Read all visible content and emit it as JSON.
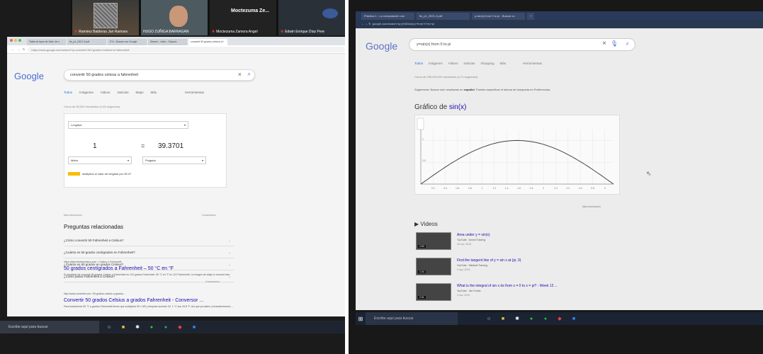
{
  "zoom": {
    "participants": [
      {
        "name": "Ramirez Balderas Jair Ramses"
      },
      {
        "name": "HUGO ZUÑIGA BARRAGAN"
      },
      {
        "name": "Moctezuma Zamora Angel",
        "big_name": "Moctezuma Ze..."
      },
      {
        "name": "Edwin Enrique Díaz Pere"
      }
    ]
  },
  "left_browser": {
    "tabs": [
      {
        "label": "Tabla de tipos de Valor de c"
      },
      {
        "label": "fis_p1_2021-3.pdf"
      },
      {
        "label": "3°A - Buscar con Google"
      },
      {
        "label": "Search - video - Edpuzz"
      },
      {
        "label": "convertir 50 grados celsius a f"
      }
    ],
    "url": "https://www.google.com/search?q=convertir+50+grados+celsius+a+fahrenheit",
    "logo": "Google",
    "search_query": "convertir 50 grados celsius a fahrenheit",
    "search_tabs": [
      "Todos",
      "Imágenes",
      "Videos",
      "Noticias",
      "Maps",
      "Más"
    ],
    "tools_label": "Herramientas",
    "result_count": "Cerca de 83,000 resultados (0,43 segundos)",
    "converter": {
      "category": "Longitud",
      "from_value": "1",
      "equals": "=",
      "to_value": "39.3701",
      "from_unit": "Metro",
      "to_unit": "Pulgada",
      "formula_text": "multiplica el valor de longitud por 39.37"
    },
    "more_info": "Más información",
    "comments_label": "Comentarios",
    "faq_title": "Preguntas relacionadas",
    "faq": [
      "¿Cómo convertir 50 Fahrenheit a Celsius?",
      "¿Cuánto es 50 grados centígrados en Fahrenheit?",
      "¿Cuánto es 50 grados en grados Celsius?",
      "¿Cómo pasar Fahrenheit a Celsius?"
    ],
    "result1": {
      "url": "https://fahrenheitacelsius.com › Celsius a Fahrenheit",
      "title": "50 grados centígrados a Fahrenheit – 50 °C en °F",
      "snippet": "El resultado de convertir 50 grados Celsius a Fahrenheit es 122 grados Fahrenheit. 50 °C en °F es 122 Fahrenheit. La imagen de abajo lo resume todo."
    },
    "result2": {
      "url": "http://www.convertir.com › 50-grados-celsius-a-grados...",
      "title": "Convertir 50 grados Celsius a grados Fahrenheit - Conversor ...",
      "snippet": "Para transformar 50 °C a grados Fahrenheit tienes que multiplicar 50 x 9/5 y después sumarle 32. 1 °C son 33,8 °F. Así que ya sabes, la transformación ..."
    },
    "taskbar_search": "Escribe aquí para buscar"
  },
  "right_browser": {
    "tabs": [
      {
        "label": "Práctica 1 - La computación con"
      },
      {
        "label": "fis_p1_2021-3.pdf"
      },
      {
        "label": "y=sin(x) from 0 to pi - Buscar co"
      }
    ],
    "url": "google.com/search?q=y%3Dsin(x)+from+0+to+pi",
    "logo": "Google",
    "search_query": "y=sin(x) from 0 to pi",
    "search_tabs": [
      "Todos",
      "Imágenes",
      "Videos",
      "Noticias",
      "Shopping",
      "Más"
    ],
    "tools_label": "Herramientas",
    "result_count": "Cerca de 295,000,000 resultados (0,74 segundos)",
    "suggestion_prefix": "Sugerencia: Buscar solo resultados en",
    "suggestion_bold": "español",
    "suggestion_suffix": ". Puedes especificar el idioma de búsqueda en Preferencias.",
    "graph_title_prefix": "Gráfico de",
    "graph_title_fn": "sin(x)",
    "more_info": "Más información",
    "videos_heading": "Videos",
    "videos": [
      {
        "title": "Area under y = sin(x)",
        "source": "YouTube · Anmol Tutoring",
        "date": "18 nov. 2015",
        "duration": "2:53"
      },
      {
        "title": "Find the tangent line of y = sin x at (pi, 0)",
        "source": "YouTube · Minilwel Tutoring",
        "date": "1 sep. 2019",
        "duration": "1:34"
      },
      {
        "title": "What is the integral of sin x dx from x = 0 to x = pi? - Week 12 ...",
        "source": "YouTube · Jim Fowler",
        "date": "3 nov. 2013",
        "duration": "2:31"
      }
    ],
    "taskbar_search": "Escribe aquí para buscar"
  },
  "chart_data": {
    "type": "line",
    "title": "Gráfico de sin(x)",
    "x_ticks": [
      "0.2",
      "0.4",
      "0.6",
      "0.8",
      "1",
      "1.2",
      "1.4",
      "1.6",
      "1.8",
      "2",
      "2.2",
      "2.4",
      "2.6",
      "2.8",
      "3"
    ],
    "y_ticks": [
      "0.5",
      "1"
    ],
    "xlim": [
      0,
      3.14159
    ],
    "ylim": [
      0,
      1.25
    ],
    "series": [
      {
        "function": "sin(x)",
        "x": [
          0,
          0.3,
          0.6,
          0.9,
          1.2,
          1.5708,
          1.9,
          2.2,
          2.5,
          2.8,
          3.14159
        ],
        "y": [
          0,
          0.2955,
          0.5646,
          0.7833,
          0.932,
          1.0,
          0.9463,
          0.8085,
          0.5985,
          0.335,
          0
        ]
      }
    ],
    "grid": true
  }
}
